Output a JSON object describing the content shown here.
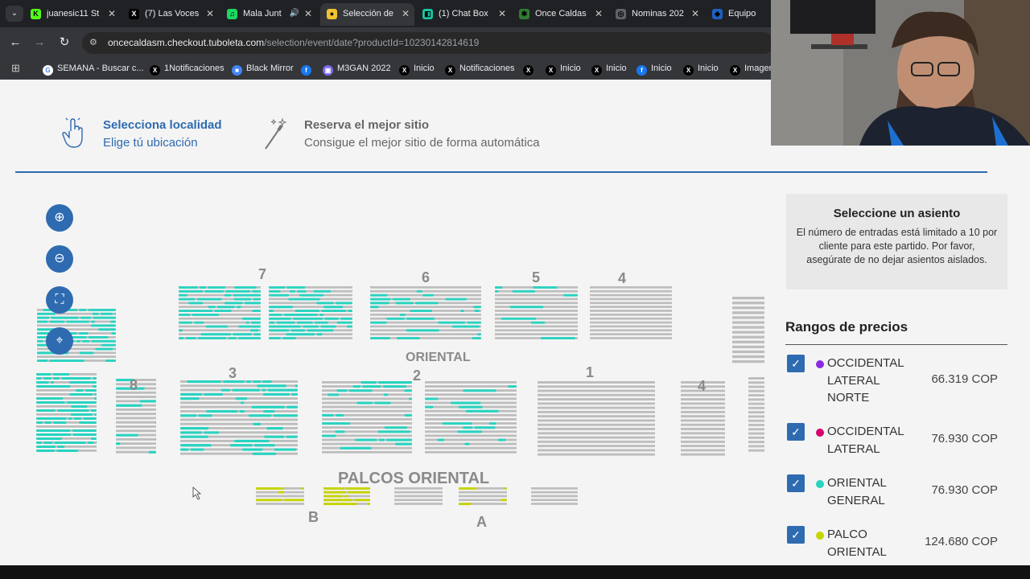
{
  "browser": {
    "tabs": [
      {
        "title": "juanesic11 St",
        "icon": "kick-icon",
        "color": "#53fc18",
        "glyph": "K"
      },
      {
        "title": "(7) Las Voces",
        "icon": "x-icon",
        "color": "#000000",
        "glyph": "X"
      },
      {
        "title": "Mala Junt",
        "icon": "spotify-icon",
        "color": "#1ed760",
        "glyph": "♫"
      },
      {
        "title": "Selección de",
        "icon": "tuboleta-icon",
        "color": "#f2c230",
        "glyph": "●"
      },
      {
        "title": "(1) Chat Box",
        "icon": "chat-icon",
        "color": "#18c6a0",
        "glyph": "◧"
      },
      {
        "title": "Once Caldas",
        "icon": "onceCaldas-icon",
        "color": "#2e7d32",
        "glyph": "✱"
      },
      {
        "title": "Nominas 202",
        "icon": "globe-icon",
        "color": "#5f6368",
        "glyph": "◎"
      },
      {
        "title": "Equipos –",
        "icon": "shield-icon",
        "color": "#1f5fbf",
        "glyph": "◆"
      }
    ],
    "url_domain": "oncecaldasm.checkout.tuboleta.com",
    "url_path": "/selection/event/date?productId=10230142814619",
    "bookmarks": [
      {
        "title": "SEMANA - Buscar c...",
        "icon": "google-icon",
        "color": "#ffffff",
        "glyph": "G"
      },
      {
        "title": "1Notificaciones",
        "icon": "x-icon",
        "color": "#000000",
        "glyph": "X"
      },
      {
        "title": "Black Mirror",
        "icon": "bookmark-icon",
        "color": "#4285f4",
        "glyph": "■"
      },
      {
        "title": "",
        "icon": "facebook-icon",
        "color": "#1877f2",
        "glyph": "f"
      },
      {
        "title": "M3GAN 2022",
        "icon": "image-icon",
        "color": "#7b68ee",
        "glyph": "▣"
      },
      {
        "title": "Inicio",
        "icon": "x-icon",
        "color": "#000000",
        "glyph": "X"
      },
      {
        "title": "Notificaciones",
        "icon": "x-icon",
        "color": "#000000",
        "glyph": "X"
      },
      {
        "title": "",
        "icon": "x-icon",
        "color": "#000000",
        "glyph": "X"
      },
      {
        "title": "Inicio",
        "icon": "x-icon",
        "color": "#000000",
        "glyph": "X"
      },
      {
        "title": "Inicio",
        "icon": "x-icon",
        "color": "#000000",
        "glyph": "X"
      },
      {
        "title": "Inicio",
        "icon": "facebook-icon",
        "color": "#1877f2",
        "glyph": "f"
      },
      {
        "title": "Inicio",
        "icon": "x-icon",
        "color": "#000000",
        "glyph": "X"
      },
      {
        "title": "Imagen",
        "icon": "x-icon",
        "color": "#000000",
        "glyph": "X"
      }
    ]
  },
  "steps": [
    {
      "title": "Selecciona localidad",
      "subtitle": "Elige tú ubicación",
      "icon": "hand-pointer-icon",
      "active": true
    },
    {
      "title": "Reserva el mejor sitio",
      "subtitle": "Consigue el mejor sitio de forma automática",
      "icon": "magic-wand-icon",
      "active": false
    }
  ],
  "map_controls": [
    {
      "name": "zoom-in-icon",
      "glyph": "⊕"
    },
    {
      "name": "zoom-out-icon",
      "glyph": "⊖"
    },
    {
      "name": "fullscreen-icon",
      "glyph": "⛶"
    },
    {
      "name": "map-pin-icon",
      "glyph": "⌖"
    }
  ],
  "stadium": {
    "section_labels": [
      "7",
      "6",
      "5",
      "4",
      "ORIENTAL",
      "8",
      "3",
      "2",
      "1",
      "4",
      "PALCOS ORIENTAL",
      "B",
      "A"
    ]
  },
  "info": {
    "title": "Seleccione un asiento",
    "text": "El número de entradas está limitado a 10 por cliente para este partido. Por favor, asegúrate de no dejar asientos aislados."
  },
  "prices": {
    "title": "Rangos de precios",
    "items": [
      {
        "name": "OCCIDENTAL LATERAL NORTE",
        "price": "66.319 COP",
        "color": "#8a2be2",
        "checked": true
      },
      {
        "name": "OCCIDENTAL LATERAL",
        "price": "76.930 COP",
        "color": "#d6006e",
        "checked": true
      },
      {
        "name": "ORIENTAL GENERAL",
        "price": "76.930 COP",
        "color": "#29d3c0",
        "checked": true
      },
      {
        "name": "PALCO ORIENTAL",
        "price": "124.680 COP",
        "color": "#c6d400",
        "checked": true
      }
    ]
  },
  "colors": {
    "accent": "#2e6bb0",
    "available_general": "#29d3c0",
    "available_palco": "#c6d400",
    "unavailable": "#bdbdbd"
  }
}
